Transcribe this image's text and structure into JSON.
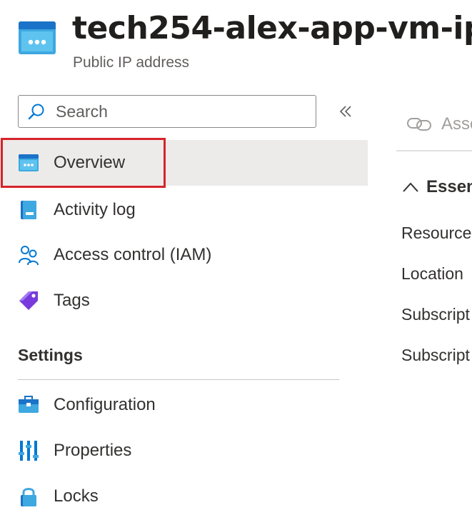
{
  "header": {
    "title": "tech254-alex-app-vm-ip",
    "subtitle": "Public IP address",
    "icon": "public-ip-icon"
  },
  "search": {
    "placeholder": "Search"
  },
  "nav": {
    "items": [
      {
        "label": "Overview",
        "icon": "overview-icon",
        "selected": true
      },
      {
        "label": "Activity log",
        "icon": "activity-log-icon"
      },
      {
        "label": "Access control (IAM)",
        "icon": "iam-icon"
      },
      {
        "label": "Tags",
        "icon": "tag-icon"
      }
    ],
    "settings_title": "Settings",
    "settings_items": [
      {
        "label": "Configuration",
        "icon": "configuration-icon"
      },
      {
        "label": "Properties",
        "icon": "properties-icon"
      },
      {
        "label": "Locks",
        "icon": "lock-icon"
      }
    ]
  },
  "main": {
    "toolbar_label": "Asso",
    "essentials_label": "Essen",
    "fields": [
      "Resource",
      "Location",
      "Subscript",
      "Subscript"
    ]
  },
  "colors": {
    "highlight": "#d7232b",
    "selected_bg": "#edebe9",
    "azure_blue": "#0078d4"
  }
}
